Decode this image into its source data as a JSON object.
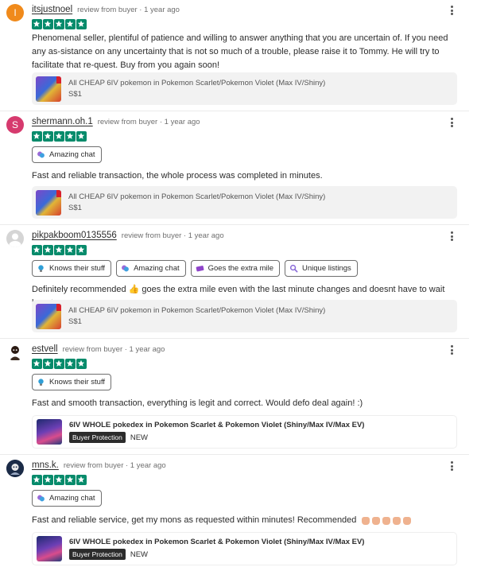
{
  "reviews": [
    {
      "username": "itsjustnoel",
      "meta": "review from buyer · 1 year ago",
      "avatar_letter": "I",
      "avatar_color": "#f08a1b",
      "rating": 5,
      "tags": [],
      "text": "Phenomenal seller, plentiful of patience and willing to answer anything that you are uncertain of. If you need any as-sistance on any uncertainty that is not so much of a trouble, please raise it to Tommy. He will try to facilitate that re-quest. Buy from you again soon!",
      "product": {
        "title": "All CHEAP 6IV pokemon in Pokemon Scarlet/Pokemon Violet (Max IV/Shiny)",
        "price": "S$1"
      }
    },
    {
      "username": "shermann.oh.1",
      "meta": "review from buyer · 1 year ago",
      "avatar_letter": "S",
      "avatar_color": "#d63a6e",
      "rating": 5,
      "tags": [
        {
          "label": "Amazing chat",
          "icon": "chat-bubbles-icon"
        }
      ],
      "text": "Fast and reliable transaction, the whole process was completed in minutes.",
      "product": {
        "title": "All CHEAP 6IV pokemon in Pokemon Scarlet/Pokemon Violet (Max IV/Shiny)",
        "price": "S$1"
      }
    },
    {
      "username": "pikpakboom0135556",
      "meta": "review from buyer · 1 year ago",
      "avatar_letter": "",
      "avatar_color": "#d5d5d5",
      "rating": 5,
      "tags": [
        {
          "label": "Knows their stuff",
          "icon": "lightbulb-icon"
        },
        {
          "label": "Amazing chat",
          "icon": "chat-bubbles-icon"
        },
        {
          "label": "Goes the extra mile",
          "icon": "ticket-icon"
        },
        {
          "label": "Unique listings",
          "icon": "magnifier-icon"
        }
      ],
      "text": "Definitely recommended 👍 goes the extra mile even with the last minute changes and doesnt have to wait long too",
      "product": {
        "title": "All CHEAP 6IV pokemon in Pokemon Scarlet/Pokemon Violet (Max IV/Shiny)",
        "price": "S$1"
      }
    },
    {
      "username": "estvell",
      "meta": "review from buyer · 1 year ago",
      "avatar_letter": "",
      "avatar_color": "#ffffff",
      "rating": 5,
      "tags": [
        {
          "label": "Knows their stuff",
          "icon": "lightbulb-icon"
        }
      ],
      "text": "Fast and smooth transaction, everything is legit and correct. Would defo deal again! :)",
      "product": {
        "title": "6IV WHOLE pokedex in Pokemon Scarlet & Pokemon Violet (Shiny/Max IV/Max EV)",
        "badge": "Buyer Protection",
        "condition": "NEW"
      }
    },
    {
      "username": "mns.k.",
      "meta": "review from buyer · 1 year ago",
      "avatar_letter": "",
      "avatar_color": "#1b2b47",
      "rating": 5,
      "tags": [
        {
          "label": "Amazing chat",
          "icon": "chat-bubbles-icon"
        }
      ],
      "text": "Fast and reliable service, get my mons as requested within minutes! Recommended",
      "product": {
        "title": "6IV WHOLE pokedex in Pokemon Scarlet & Pokemon Violet (Shiny/Max IV/Max EV)",
        "badge": "Buyer Protection",
        "condition": "NEW"
      }
    }
  ]
}
